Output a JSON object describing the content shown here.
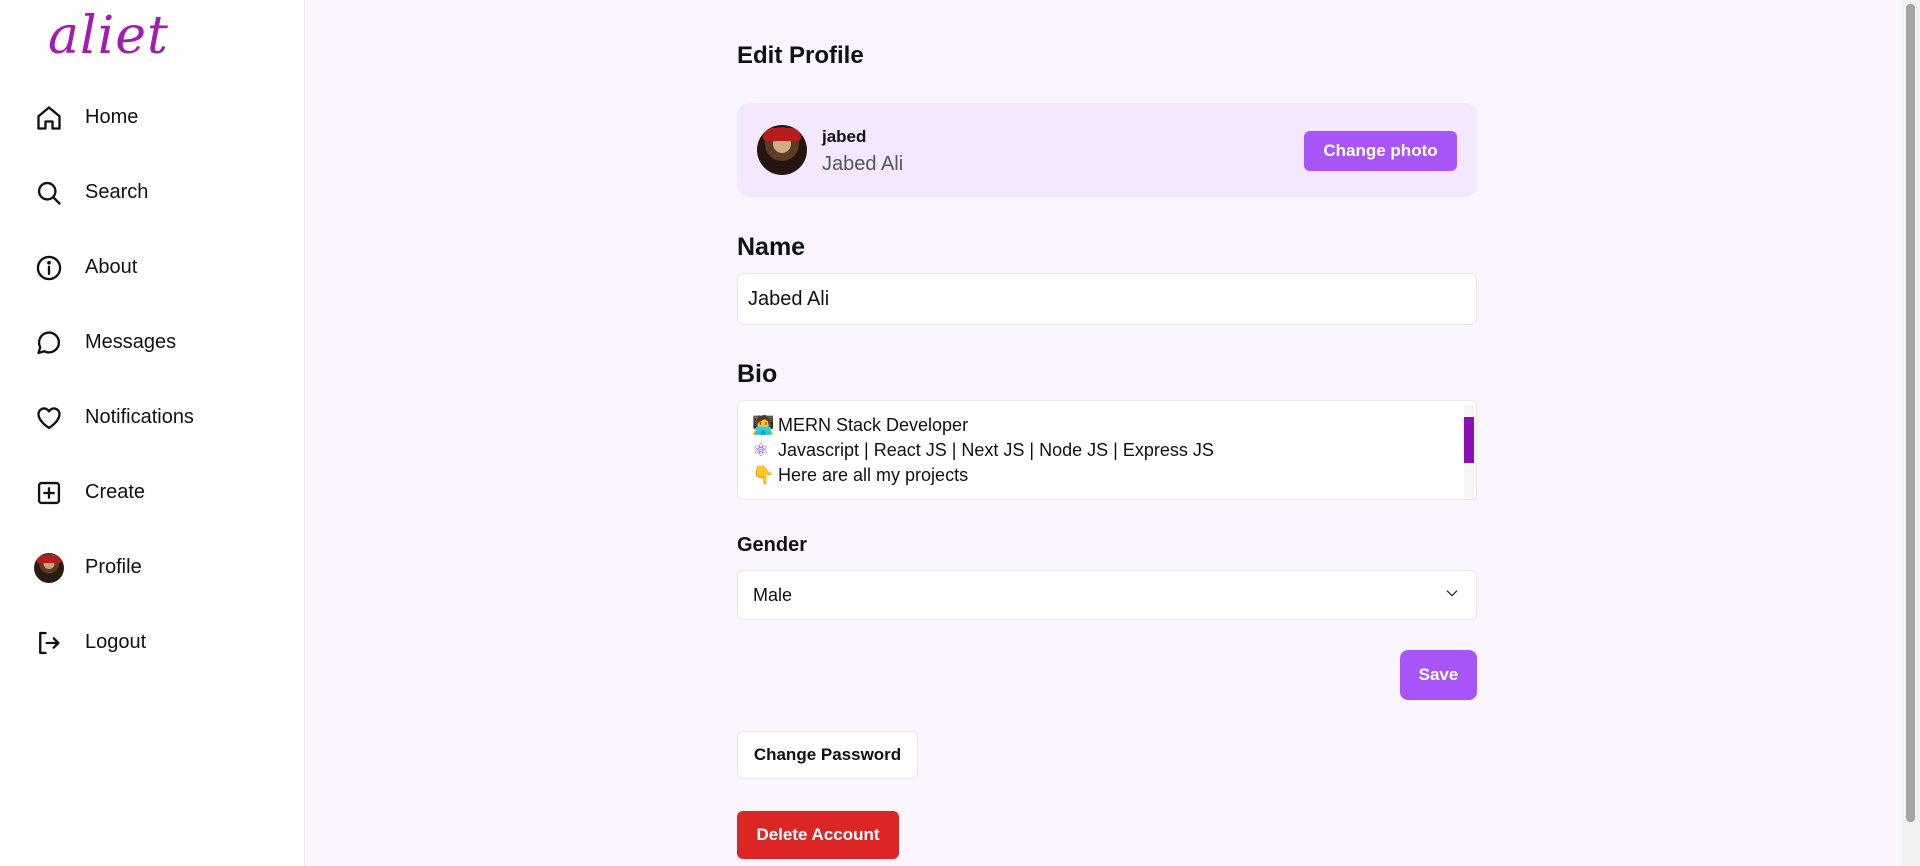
{
  "brand": {
    "logo_text": "aliet"
  },
  "sidebar": {
    "items": [
      {
        "label": "Home",
        "icon": "home-icon"
      },
      {
        "label": "Search",
        "icon": "search-icon"
      },
      {
        "label": "About",
        "icon": "info-icon"
      },
      {
        "label": "Messages",
        "icon": "message-icon"
      },
      {
        "label": "Notifications",
        "icon": "heart-icon"
      },
      {
        "label": "Create",
        "icon": "plus-square-icon"
      },
      {
        "label": "Profile",
        "icon": "avatar"
      },
      {
        "label": "Logout",
        "icon": "logout-icon"
      }
    ]
  },
  "page": {
    "title": "Edit Profile"
  },
  "profile": {
    "username": "jabed",
    "full_name": "Jabed Ali",
    "change_photo_label": "Change photo"
  },
  "form": {
    "name_label": "Name",
    "name_value": "Jabed Ali",
    "bio_label": "Bio",
    "bio_lines": [
      {
        "emoji": "🧑‍💻",
        "text": "MERN Stack Developer"
      },
      {
        "emoji": "⚛",
        "text": "Javascript | React JS | Next JS | Node JS | Express JS"
      },
      {
        "emoji": "👇",
        "text": "Here are all my projects"
      }
    ],
    "gender_label": "Gender",
    "gender_value": "Male",
    "save_label": "Save"
  },
  "account": {
    "change_password_label": "Change Password",
    "delete_account_label": "Delete Account"
  },
  "colors": {
    "accent": "#a855f7",
    "danger": "#dc2626",
    "background": "#faf5ff",
    "card": "#f3e8ff"
  }
}
